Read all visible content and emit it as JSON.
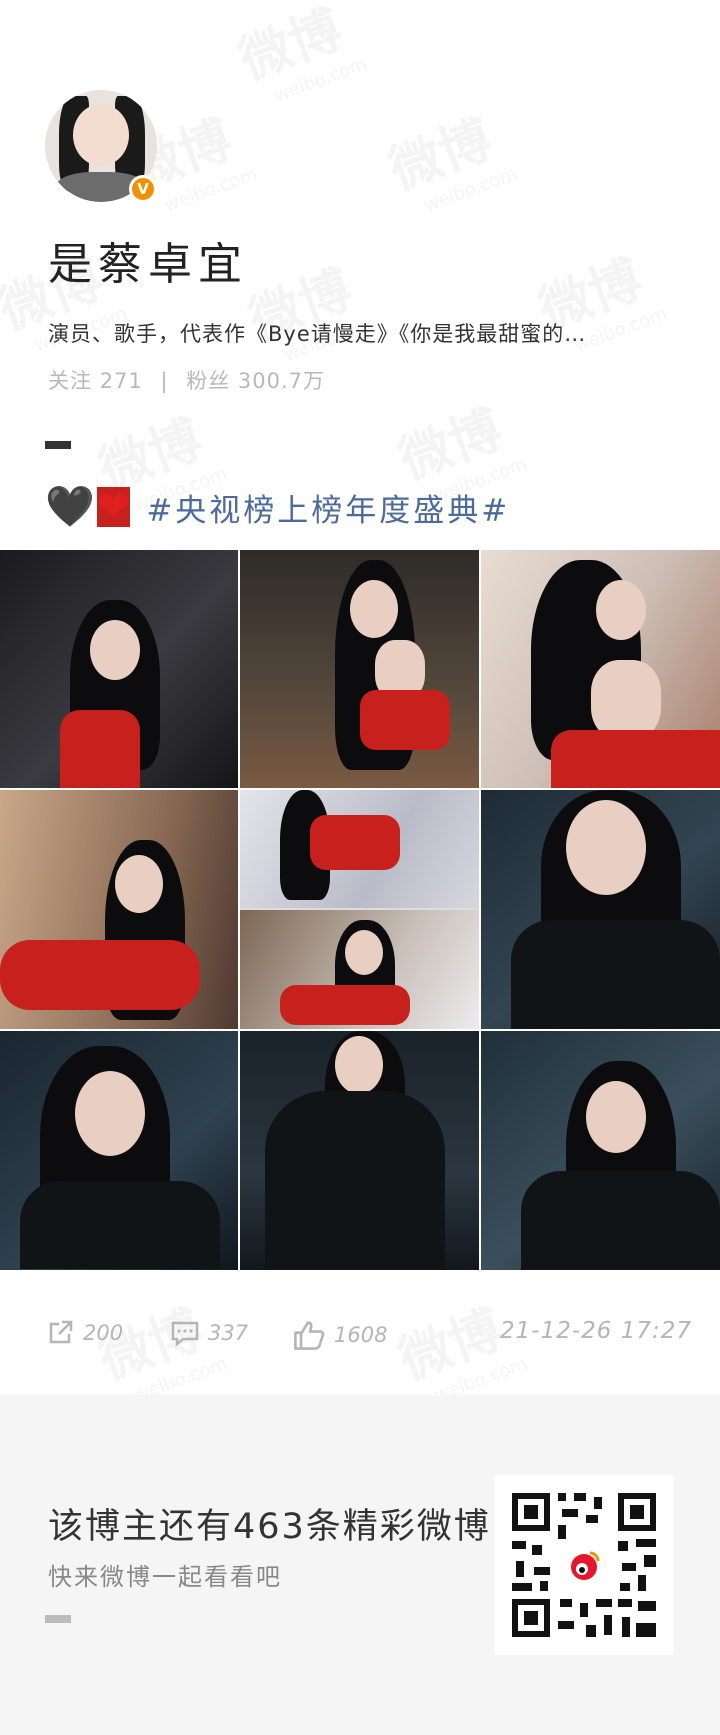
{
  "profile": {
    "name": "是蔡卓宜",
    "bio": "演员、歌手，代表作《Bye请慢走》《你是我最甜蜜的…",
    "following_label": "关注",
    "following_count": "271",
    "fans_label": "粉丝",
    "fans_count": "300.7万"
  },
  "post": {
    "topic": "#央视榜上榜年度盛典#",
    "emoji_black_heart": "🖤",
    "emoji_red_heart": "❤"
  },
  "actions": {
    "repost_count": "200",
    "comment_count": "337",
    "like_count": "1608",
    "timestamp": "21-12-26 17:27"
  },
  "footer": {
    "promo_title": "该博主还有463条精彩微博",
    "promo_subtitle": "快来微博一起看看吧"
  },
  "watermark": {
    "brand": "微博",
    "domain": "weibo.com"
  },
  "colors": {
    "verified_badge": "#f29100",
    "topic_link": "#4c6b9c",
    "heart_red": "#e0201f",
    "muted": "#b5b5b5"
  },
  "icons": [
    "verified-icon",
    "repost-icon",
    "comment-icon",
    "like-icon",
    "qr-code-icon"
  ]
}
